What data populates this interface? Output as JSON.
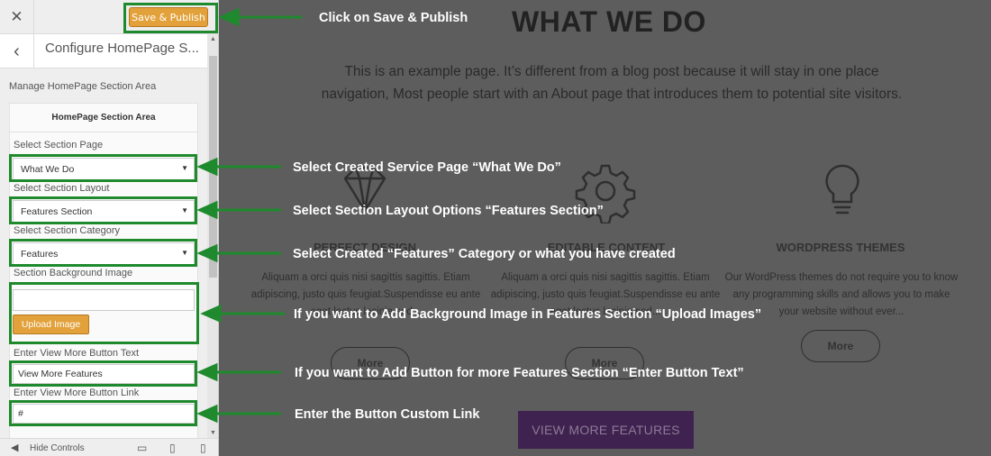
{
  "sidebar": {
    "close_icon": "close-icon",
    "save_label": "Save & Publish",
    "panel_title": "Configure HomePage S...",
    "manage_label": "Manage HomePage Section Area",
    "section_heading": "HomePage Section Area",
    "fields": {
      "section_page_label": "Select Section Page",
      "section_page_value": "What We Do",
      "section_layout_label": "Select Section Layout",
      "section_layout_value": "Features Section",
      "section_category_label": "Select Section Category",
      "section_category_value": "Features",
      "bg_image_label": "Section Background Image",
      "upload_label": "Upload Image",
      "button_text_label": "Enter View More Button Text",
      "button_text_value": "View More Features",
      "button_link_label": "Enter View More Button Link",
      "button_link_value": "#"
    },
    "footer": {
      "hide_label": "Hide Controls"
    }
  },
  "preview": {
    "title": "WHAT WE DO",
    "intro": "This is an example page. It’s different from a blog post because it will stay in one place  navigation,  Most people start with an About page that introduces them to potential site visitors.",
    "features": [
      {
        "icon": "diamond-icon",
        "title": "PERFECT DESIGN",
        "text": "Aliquam a orci quis nisi sagittis sagittis. Etiam adipiscing, justo quis feugiat.Suspendisse eu ante eget lectus lacinia sed...",
        "button": "More"
      },
      {
        "icon": "gear-icon",
        "title": "EDITABLE CONTENT",
        "text": "Aliquam a orci quis nisi sagittis sagittis. Etiam adipiscing, justo quis feugiat.Suspendisse eu ante eget lectus lacinia sed...",
        "button": "More"
      },
      {
        "icon": "lightbulb-icon",
        "title": "WORDPRESS THEMES",
        "text": "Our WordPress themes do not require you to know any programming skills and allows you to make your website without ever...",
        "button": "More"
      }
    ],
    "view_more_label": "VIEW MORE FEATURES"
  },
  "annotations": [
    "Click on Save & Publish",
    "Select Created Service Page “What We Do”",
    "Select Section Layout Options “Features Section”",
    "Select Created “Features” Category or what you have created",
    "If you want to Add Background Image in Features Section “Upload Images”",
    "If you want to Add Button for more  Features Section “Enter Button Text”",
    "Enter the Button Custom Link"
  ],
  "colors": {
    "accent": "#e2a13a",
    "annotation_green": "#1e8a2d",
    "overlay": "#5d5d5d",
    "view_more_bg": "#3f2250"
  }
}
